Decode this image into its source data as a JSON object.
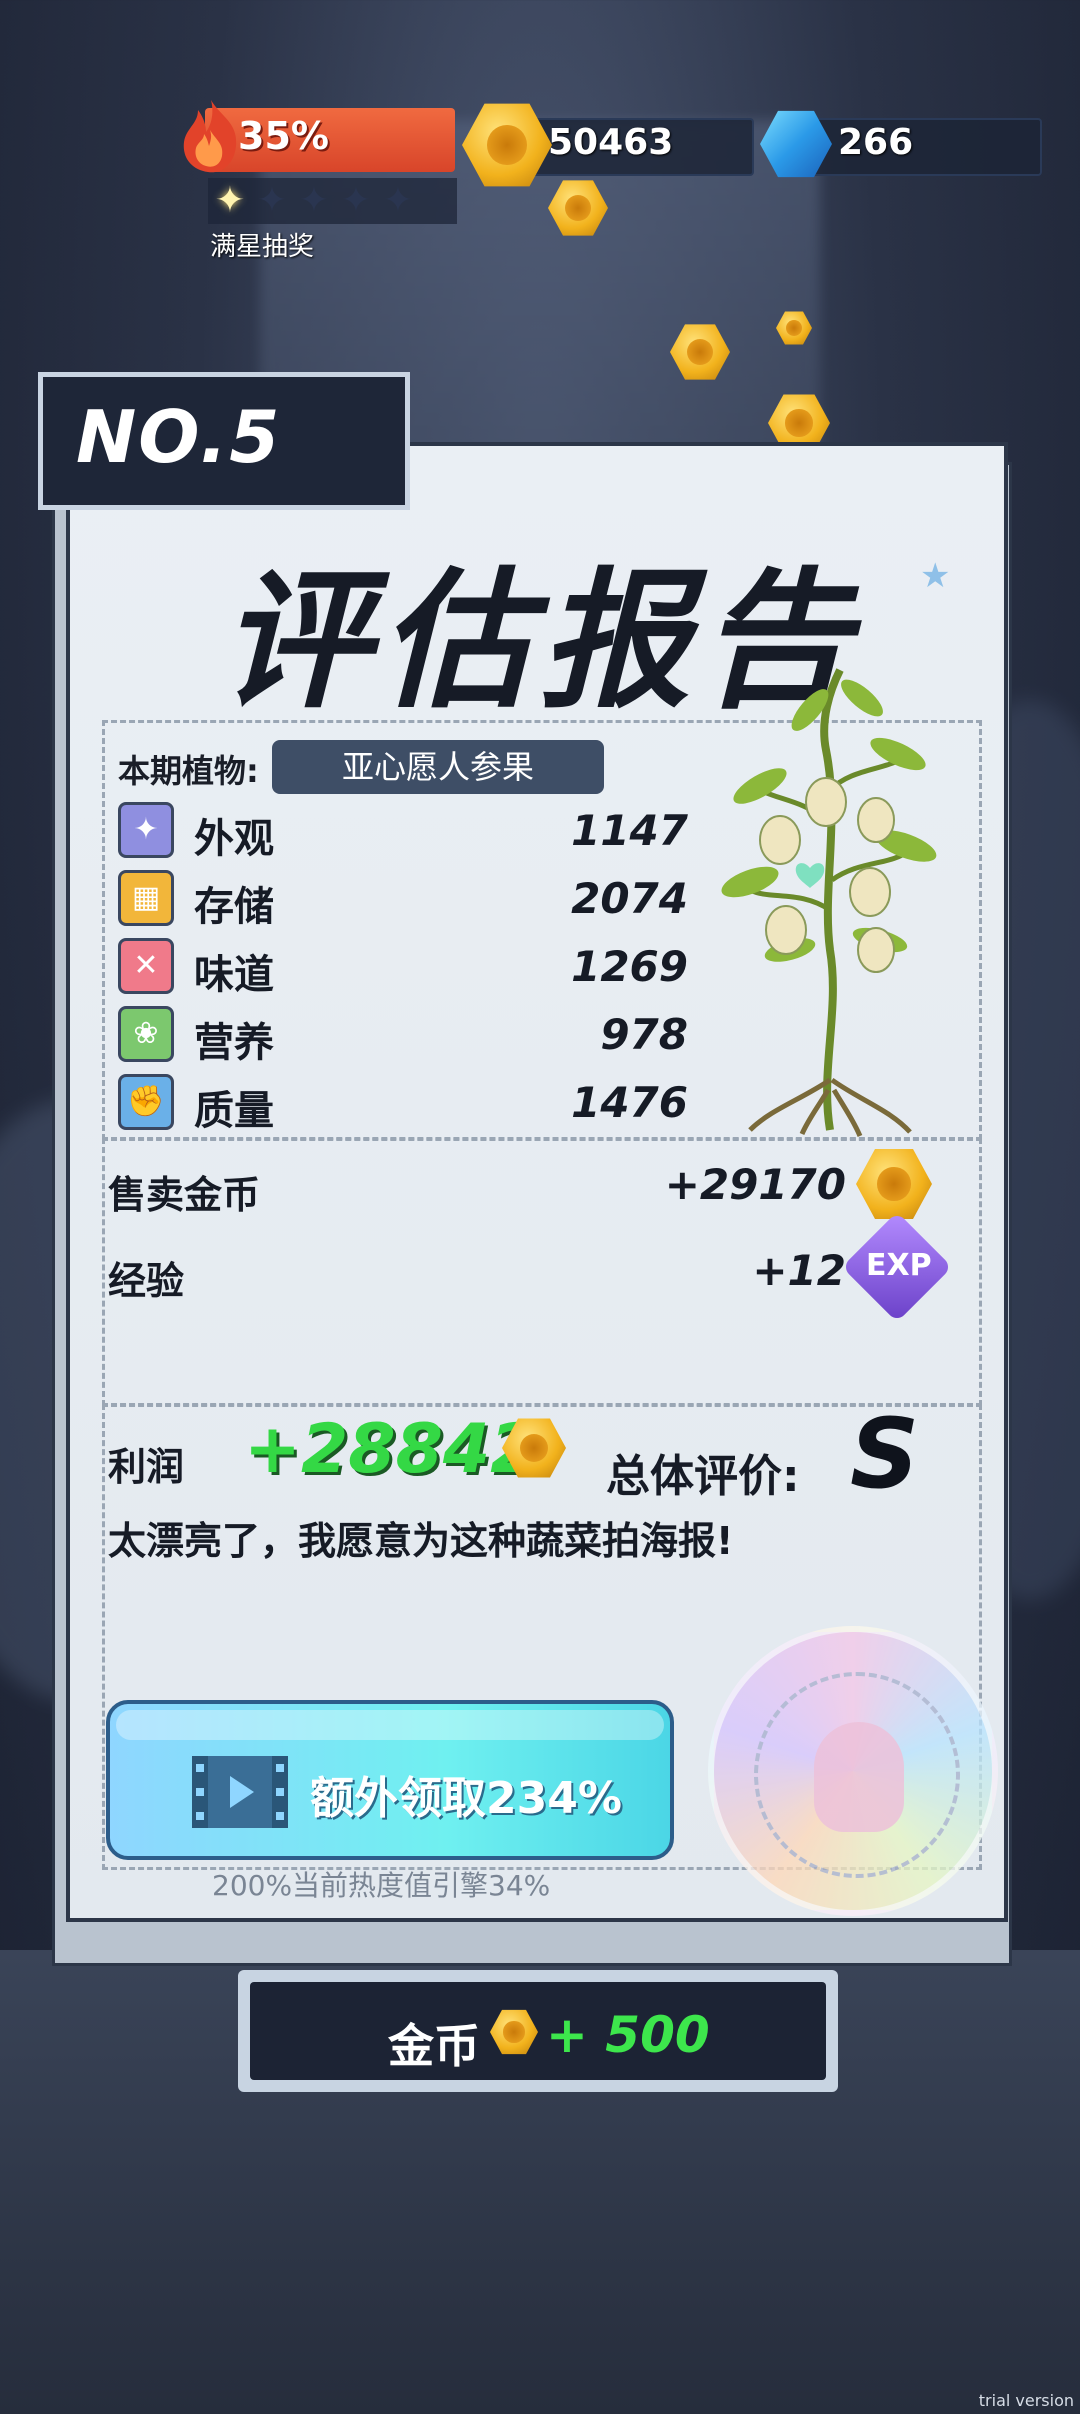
{
  "hud": {
    "heat_percent_label": "35%",
    "heat_percent": 0.35,
    "stars_total": 5,
    "stars_filled": 1,
    "stars_label": "满星抽奖",
    "coins": "50463",
    "gems": "266"
  },
  "report": {
    "number_tag": "NO.5",
    "title": "评估报告",
    "plant_label": "本期植物:",
    "plant_name": "亚心愿人参果",
    "attributes": [
      {
        "label": "外观",
        "value": "1147",
        "icon": "sparkle-icon",
        "color": "#8f8fe0"
      },
      {
        "label": "存储",
        "value": "2074",
        "icon": "box-icon",
        "color": "#f2b63a"
      },
      {
        "label": "味道",
        "value": "1269",
        "icon": "utensils-icon",
        "color": "#f07a8a"
      },
      {
        "label": "营养",
        "value": "978",
        "icon": "nutrition-icon",
        "color": "#7cc86e"
      },
      {
        "label": "质量",
        "value": "1476",
        "icon": "muscle-icon",
        "color": "#6ab0e8"
      }
    ],
    "sell_label": "售卖金币",
    "sell_value": "+29170",
    "exp_label": "经验",
    "exp_value": "+12",
    "exp_badge": "EXP",
    "profit_label": "利润",
    "profit_value": "+28842",
    "grade_label": "总体评价:",
    "grade": "S",
    "comment": "太漂亮了，我愿意为这种蔬菜拍海报!",
    "claim_label": "额外领取234%",
    "claim_note": "200%当前热度值引擎34%"
  },
  "bottom": {
    "label": "金币",
    "amount": "+ 500"
  },
  "watermark": "trial version",
  "colors": {
    "accent_green": "#34d845",
    "card_bg": "#e6ebf1",
    "dark_navy": "#1e2638"
  }
}
